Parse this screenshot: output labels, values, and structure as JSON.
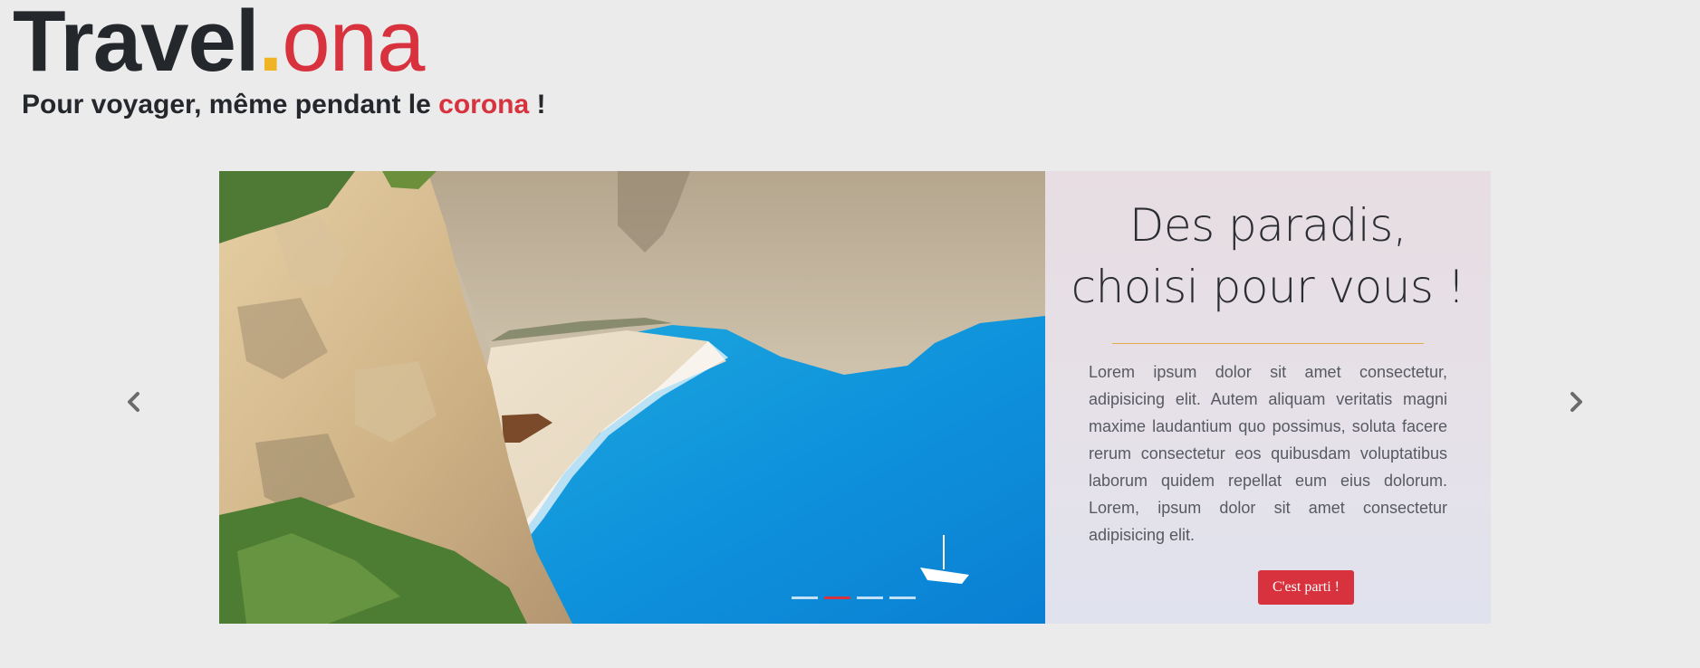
{
  "header": {
    "logo": {
      "brand": "Travel",
      "dot": ".",
      "suffix": "ona"
    },
    "tagline": {
      "before": "Pour voyager, même pendant le ",
      "accent": "corona",
      "after": " !"
    }
  },
  "carousel": {
    "slide_image": "beach-cove-photo",
    "caption": {
      "title": "Des paradis, choisi pour vous !",
      "body": "Lorem ipsum dolor sit amet consectetur, adipisicing elit. Autem aliquam veritatis magni maxime laudantium quo possimus, soluta facere rerum consectetur eos quibusdam voluptatibus laborum quidem repellat eum eius dolorum. Lorem, ipsum dolor sit amet consectetur adipisicing elit.",
      "button_label": "C'est parti !"
    },
    "indicators": {
      "count": 4,
      "active_index": 1
    },
    "prev_icon": "chevron-left-icon",
    "next_icon": "chevron-right-icon"
  },
  "colors": {
    "background": "#ebebeb",
    "brand_dark": "#24272b",
    "accent_red": "#d7323d",
    "accent_gold": "#f0b323"
  }
}
